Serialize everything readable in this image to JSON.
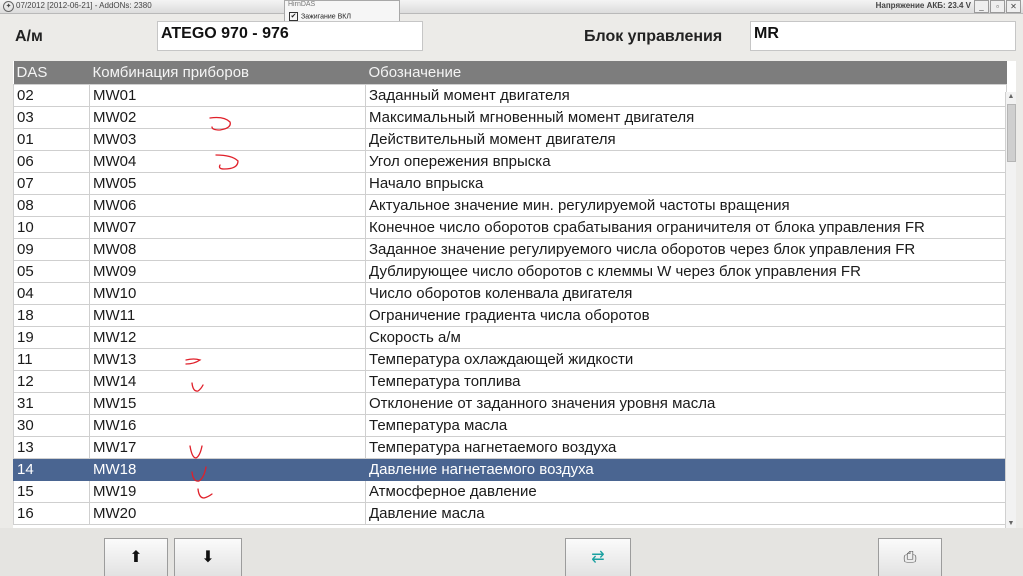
{
  "window": {
    "title": "07/2012 [2012-06-21] - AddONs: 2380",
    "battery_voltage": "Напряжение АКБ: 23.4 V",
    "controls": {
      "minimize": "_",
      "restore": "▫",
      "close": "✕"
    }
  },
  "popup": {
    "title": "HirnDAS",
    "item_label": "Зажигание ВКЛ",
    "item_checked": true
  },
  "header": {
    "vehicle_label": "А/м",
    "vehicle_value": "ATEGO 970 - 976",
    "ecu_label": "Блок управления",
    "ecu_value": "MR"
  },
  "table": {
    "columns": [
      "DAS",
      "Комбинация приборов",
      "Обозначение"
    ],
    "selected_index": 18,
    "rows": [
      {
        "das": "02",
        "code": "MW01",
        "name": "Заданный момент двигателя"
      },
      {
        "das": "03",
        "code": "MW02",
        "name": "Максимальный мгновенный момент двигателя"
      },
      {
        "das": "01",
        "code": "MW03",
        "name": "Действительный момент двигателя"
      },
      {
        "das": "06",
        "code": "MW04",
        "name": "Угол опережения впрыска"
      },
      {
        "das": "07",
        "code": "MW05",
        "name": "Начало впрыска"
      },
      {
        "das": "08",
        "code": "MW06",
        "name": "Актуальное значение мин. регулируемой частоты вращения"
      },
      {
        "das": "10",
        "code": "MW07",
        "name": "Конечное число оборотов срабатывания ограничителя от блока управления FR"
      },
      {
        "das": "09",
        "code": "MW08",
        "name": "Заданное значение регулируемого числа оборотов через блок управления FR"
      },
      {
        "das": "05",
        "code": "MW09",
        "name": "Дублирующее число оборотов с клеммы W через блок управления FR"
      },
      {
        "das": "04",
        "code": "MW10",
        "name": "Число оборотов коленвала двигателя"
      },
      {
        "das": "18",
        "code": "MW11",
        "name": "Ограничение градиента числа оборотов"
      },
      {
        "das": "19",
        "code": "MW12",
        "name": "Скорость а/м"
      },
      {
        "das": "11",
        "code": "MW13",
        "name": "Температура охлаждающей жидкости"
      },
      {
        "das": "12",
        "code": "MW14",
        "name": "Температура топлива"
      },
      {
        "das": "31",
        "code": "MW15",
        "name": "Отклонение от заданного значения уровня масла"
      },
      {
        "das": "30",
        "code": "MW16",
        "name": "Температура масла"
      },
      {
        "das": "13",
        "code": "MW17",
        "name": "Температура нагнетаемого воздуха"
      },
      {
        "das": "14",
        "code": "MW18",
        "name": "Давление нагнетаемого воздуха"
      },
      {
        "das": "15",
        "code": "MW19",
        "name": "Атмосферное давление"
      },
      {
        "das": "16",
        "code": "MW20",
        "name": "Давление масла"
      }
    ]
  },
  "toolbar": {
    "up_icon": "arrow-up-icon",
    "down_icon": "arrow-down-icon",
    "refresh_icon": "swap-arrows-icon",
    "print_icon": "printer-icon",
    "accent": "#1aa0a0"
  },
  "colors": {
    "header_bg": "#7d7d7d",
    "selected_row": "#4a6591",
    "annotation": "#e0202a"
  }
}
